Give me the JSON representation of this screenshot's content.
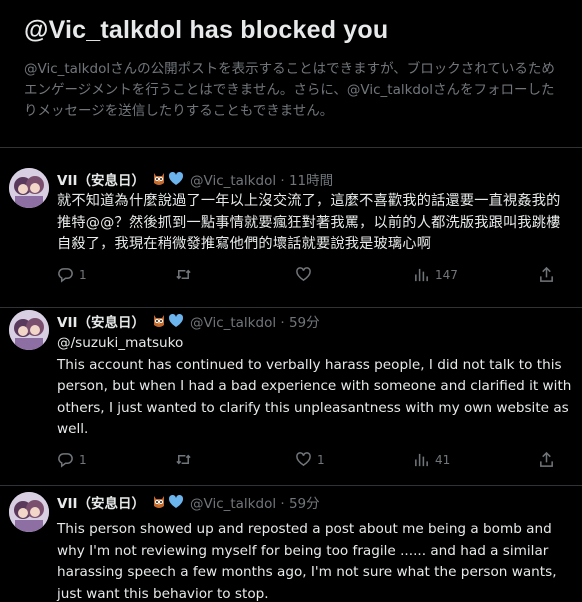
{
  "blocked": {
    "title": "@Vic_talkdol has blocked you",
    "message": "@Vic_talkdolさんの公開ポストを表示することはできますが、ブロックされているためエンゲージメントを行うことはできません。さらに、@Vic_talkdolさんをフォローしたりメッセージを送信したりすることもできません。"
  },
  "tweets": [
    {
      "author": "VII（安息日）",
      "meta": "@Vic_talkdol · 11時間",
      "text": "就不知道為什麼說過了一年以上沒交流了，這麼不喜歡我的話還要一直視姦我的推特@@？然後抓到一點事情就要瘋狂對著我罵，以前的人都洗版我跟叫我跳樓自殺了，我現在稍微發推寫他們的壞話就要說我是玻璃心啊",
      "reply_count": "1",
      "retweet_count": "",
      "like_count": "",
      "view_count": "147"
    },
    {
      "author": "VII（安息日）",
      "meta": "@Vic_talkdol · 59分",
      "mention": "@/suzuki_matsuko",
      "text": "This account has continued to verbally harass people, I did not talk to this person, but when I had a bad experience with someone and clarified it with others, I just wanted to clarify this unpleasantness with my own website as well.",
      "reply_count": "1",
      "retweet_count": "",
      "like_count": "1",
      "view_count": "41"
    },
    {
      "author": "VII（安息日）",
      "meta": "@Vic_talkdol · 59分",
      "text": "This person showed up and reposted a post about me being a bomb and why I'm not reviewing myself for being too fragile ...... and had a similar harassing speech a few months ago, I'm not sure what the person wants, just want this behavior to stop."
    }
  ],
  "icons": {
    "badge_1": "owl-emoji-icon",
    "badge_2": "blue-heart-icon",
    "reply": "reply-icon",
    "retweet": "retweet-icon",
    "like": "like-icon",
    "views": "views-icon",
    "share": "share-icon",
    "more": "more-icon"
  },
  "colors": {
    "background": "#000000",
    "text": "#e7e9ea",
    "secondary": "#71767b",
    "divider": "#2f3336",
    "heart": "#6cb4ee"
  }
}
